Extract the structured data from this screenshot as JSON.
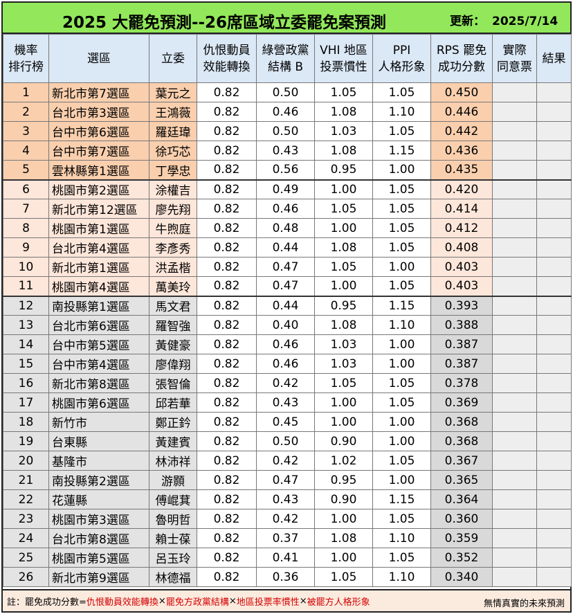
{
  "header": {
    "title": "2025 大罷免預測--26席區域立委罷免案預測",
    "updated_label": "更新：",
    "updated_date": "2025/7/14"
  },
  "columns": [
    {
      "l1": "機率",
      "l2": "排行榜"
    },
    {
      "l1": "選區",
      "l2": ""
    },
    {
      "l1": "立委",
      "l2": ""
    },
    {
      "l1": "仇恨動員",
      "l2": "效能轉換"
    },
    {
      "l1": "綠營政黨",
      "l2": "結構 B"
    },
    {
      "l1": "VHI 地區",
      "l2": "投票慣性"
    },
    {
      "l1": "PPI",
      "l2": "人格形象"
    },
    {
      "l1": "RPS 罷免",
      "l2": "成功分數"
    },
    {
      "l1": "實際",
      "l2": "同意票"
    },
    {
      "l1": "結果",
      "l2": ""
    }
  ],
  "rows": [
    {
      "rank": "1",
      "district": "新北市第7選區",
      "legislator": "葉元之",
      "hate": "0.82",
      "green": "0.50",
      "vhi": "1.05",
      "ppi": "1.05",
      "rps": "0.450",
      "actual": "",
      "result": ""
    },
    {
      "rank": "2",
      "district": "台北市第3選區",
      "legislator": "王鴻薇",
      "hate": "0.82",
      "green": "0.46",
      "vhi": "1.08",
      "ppi": "1.10",
      "rps": "0.446",
      "actual": "",
      "result": ""
    },
    {
      "rank": "3",
      "district": "台中市第6選區",
      "legislator": "羅廷瑋",
      "hate": "0.82",
      "green": "0.50",
      "vhi": "1.03",
      "ppi": "1.05",
      "rps": "0.442",
      "actual": "",
      "result": ""
    },
    {
      "rank": "4",
      "district": "台中市第7選區",
      "legislator": "徐巧芯",
      "hate": "0.82",
      "green": "0.43",
      "vhi": "1.08",
      "ppi": "1.15",
      "rps": "0.436",
      "actual": "",
      "result": ""
    },
    {
      "rank": "5",
      "district": "雲林縣第1選區",
      "legislator": "丁學忠",
      "hate": "0.82",
      "green": "0.56",
      "vhi": "0.95",
      "ppi": "1.00",
      "rps": "0.435",
      "actual": "",
      "result": ""
    },
    {
      "rank": "6",
      "district": "桃園市第2選區",
      "legislator": "涂權吉",
      "hate": "0.82",
      "green": "0.49",
      "vhi": "1.00",
      "ppi": "1.05",
      "rps": "0.420",
      "actual": "",
      "result": ""
    },
    {
      "rank": "7",
      "district": "新北市第12選區",
      "legislator": "廖先翔",
      "hate": "0.82",
      "green": "0.46",
      "vhi": "1.05",
      "ppi": "1.05",
      "rps": "0.414",
      "actual": "",
      "result": ""
    },
    {
      "rank": "8",
      "district": "桃園市第1選區",
      "legislator": "牛煦庭",
      "hate": "0.82",
      "green": "0.48",
      "vhi": "1.00",
      "ppi": "1.05",
      "rps": "0.412",
      "actual": "",
      "result": ""
    },
    {
      "rank": "9",
      "district": "台北市第4選區",
      "legislator": "李彥秀",
      "hate": "0.82",
      "green": "0.44",
      "vhi": "1.08",
      "ppi": "1.05",
      "rps": "0.408",
      "actual": "",
      "result": ""
    },
    {
      "rank": "10",
      "district": "新北市第1選區",
      "legislator": "洪孟楷",
      "hate": "0.82",
      "green": "0.47",
      "vhi": "1.05",
      "ppi": "1.00",
      "rps": "0.403",
      "actual": "",
      "result": ""
    },
    {
      "rank": "11",
      "district": "桃園市第4選區",
      "legislator": "萬美玲",
      "hate": "0.82",
      "green": "0.47",
      "vhi": "1.00",
      "ppi": "1.05",
      "rps": "0.403",
      "actual": "",
      "result": ""
    },
    {
      "rank": "12",
      "district": "南投縣第1選區",
      "legislator": "馬文君",
      "hate": "0.82",
      "green": "0.44",
      "vhi": "0.95",
      "ppi": "1.15",
      "rps": "0.393",
      "actual": "",
      "result": ""
    },
    {
      "rank": "13",
      "district": "台北市第6選區",
      "legislator": "羅智強",
      "hate": "0.82",
      "green": "0.40",
      "vhi": "1.08",
      "ppi": "1.10",
      "rps": "0.388",
      "actual": "",
      "result": ""
    },
    {
      "rank": "14",
      "district": "台中市第5選區",
      "legislator": "黃健豪",
      "hate": "0.82",
      "green": "0.46",
      "vhi": "1.03",
      "ppi": "1.00",
      "rps": "0.387",
      "actual": "",
      "result": ""
    },
    {
      "rank": "15",
      "district": "台中市第4選區",
      "legislator": "廖偉翔",
      "hate": "0.82",
      "green": "0.46",
      "vhi": "1.03",
      "ppi": "1.00",
      "rps": "0.387",
      "actual": "",
      "result": ""
    },
    {
      "rank": "16",
      "district": "新北市第8選區",
      "legislator": "張智倫",
      "hate": "0.82",
      "green": "0.42",
      "vhi": "1.05",
      "ppi": "1.05",
      "rps": "0.378",
      "actual": "",
      "result": ""
    },
    {
      "rank": "17",
      "district": "桃園市第6選區",
      "legislator": "邱若華",
      "hate": "0.82",
      "green": "0.43",
      "vhi": "1.00",
      "ppi": "1.05",
      "rps": "0.369",
      "actual": "",
      "result": ""
    },
    {
      "rank": "18",
      "district": "新竹市",
      "legislator": "鄭正鈐",
      "hate": "0.82",
      "green": "0.45",
      "vhi": "1.00",
      "ppi": "1.00",
      "rps": "0.368",
      "actual": "",
      "result": ""
    },
    {
      "rank": "19",
      "district": "台東縣",
      "legislator": "黃建賓",
      "hate": "0.82",
      "green": "0.50",
      "vhi": "0.90",
      "ppi": "1.00",
      "rps": "0.368",
      "actual": "",
      "result": ""
    },
    {
      "rank": "20",
      "district": "基隆市",
      "legislator": "林沛祥",
      "hate": "0.82",
      "green": "0.42",
      "vhi": "1.02",
      "ppi": "1.05",
      "rps": "0.367",
      "actual": "",
      "result": ""
    },
    {
      "rank": "21",
      "district": "南投縣第2選區",
      "legislator": "游顥",
      "hate": "0.82",
      "green": "0.47",
      "vhi": "0.95",
      "ppi": "1.00",
      "rps": "0.365",
      "actual": "",
      "result": ""
    },
    {
      "rank": "22",
      "district": "花蓮縣",
      "legislator": "傅崐萁",
      "hate": "0.82",
      "green": "0.43",
      "vhi": "0.90",
      "ppi": "1.15",
      "rps": "0.364",
      "actual": "",
      "result": ""
    },
    {
      "rank": "23",
      "district": "桃園市第3選區",
      "legislator": "魯明哲",
      "hate": "0.82",
      "green": "0.42",
      "vhi": "1.00",
      "ppi": "1.05",
      "rps": "0.360",
      "actual": "",
      "result": ""
    },
    {
      "rank": "24",
      "district": "台北市第8選區",
      "legislator": "賴士葆",
      "hate": "0.82",
      "green": "0.37",
      "vhi": "1.08",
      "ppi": "1.10",
      "rps": "0.359",
      "actual": "",
      "result": ""
    },
    {
      "rank": "25",
      "district": "桃園市第5選區",
      "legislator": "呂玉玲",
      "hate": "0.82",
      "green": "0.41",
      "vhi": "1.00",
      "ppi": "1.05",
      "rps": "0.352",
      "actual": "",
      "result": ""
    },
    {
      "rank": "26",
      "district": "新北市第9選區",
      "legislator": "林德福",
      "hate": "0.82",
      "green": "0.36",
      "vhi": "1.05",
      "ppi": "1.10",
      "rps": "0.340",
      "actual": "",
      "result": ""
    }
  ],
  "footer": {
    "note_prefix": "註：罷免成功分數=",
    "f1": "仇恨動員效能轉換",
    "op1": "×",
    "f2": "罷免方政黨結構",
    "op2": "×",
    "f3": "地區投票率慣性",
    "op3": "×",
    "f4": "被罷方人格形象",
    "right_text": "無情真實的未來預測"
  },
  "colors": {
    "title_bg": "#92e85a",
    "header_bg": "#dbe8f6",
    "tier_top": "#f9cfae",
    "tier_mid": "#fde6da",
    "tier_low": "#e3e3e3",
    "formula_red": "#d40000"
  }
}
